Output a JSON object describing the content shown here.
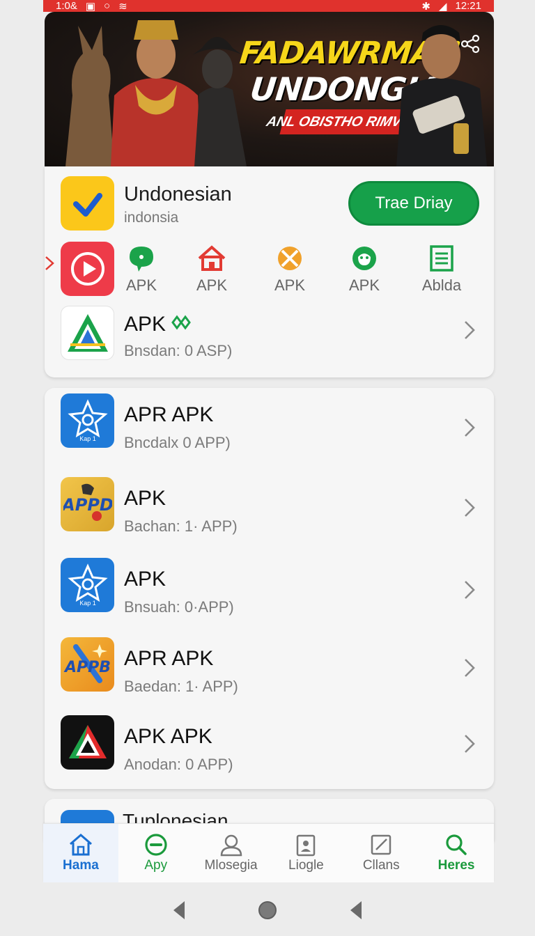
{
  "status_bar": {
    "time_left": "1:0&",
    "time_right": "12:21"
  },
  "banner": {
    "headline_1": "FADAWRMAN",
    "headline_2": "UNDONGIA",
    "tagline": "ANL OBISTHO RIMVE R3TPY"
  },
  "featured": {
    "title": "Undonesian",
    "subtitle": "indonsia",
    "button_label": "Trae Driay"
  },
  "categories": [
    {
      "label": "APK",
      "icon": "chat-bubble-icon",
      "color": "#1ba34a"
    },
    {
      "label": "APK",
      "icon": "house-icon",
      "color": "#e23b33"
    },
    {
      "label": "APK",
      "icon": "tools-icon",
      "color": "#f0a12b"
    },
    {
      "label": "APK",
      "icon": "face-chat-icon",
      "color": "#1ba34a"
    },
    {
      "label": "Ablda",
      "icon": "document-icon",
      "color": "#1ba34a"
    }
  ],
  "list_top": {
    "title": "APK",
    "subtitle": "Bnsdan: 0 ASP)"
  },
  "apps": [
    {
      "title": "APR APK",
      "subtitle": "Bncdalx 0 APP)",
      "icon": "star-badge-icon",
      "icon_text": "Kаp 1"
    },
    {
      "title": "APK",
      "subtitle": "Bachan: 1· APP)",
      "icon": "appd-icon",
      "icon_text": "APPD"
    },
    {
      "title": "APK",
      "subtitle": "Bnsuah: 0·APP)",
      "icon": "star-badge-icon",
      "icon_text": "Kаp 1"
    },
    {
      "title": "APR APK",
      "subtitle": "Baedan: 1· APP)",
      "icon": "appb-icon",
      "icon_text": "APPB"
    },
    {
      "title": "APK APK",
      "subtitle": "Anodan: 0  APP)",
      "icon": "triangle-logo-icon",
      "icon_text": ""
    }
  ],
  "partial_item": {
    "title": "Tuplonesian"
  },
  "bottom_nav": [
    {
      "label": "Hama",
      "icon": "home-icon"
    },
    {
      "label": "Apy",
      "icon": "apps-icon"
    },
    {
      "label": "Mlosegia",
      "icon": "person-icon"
    },
    {
      "label": "Liogle",
      "icon": "badge-icon"
    },
    {
      "label": "Cllans",
      "icon": "edit-icon"
    },
    {
      "label": "Heres",
      "icon": "search-icon"
    }
  ],
  "colors": {
    "accent_green": "#16a04a",
    "status_red": "#e0322d",
    "nav_blue": "#1a6fd1"
  }
}
